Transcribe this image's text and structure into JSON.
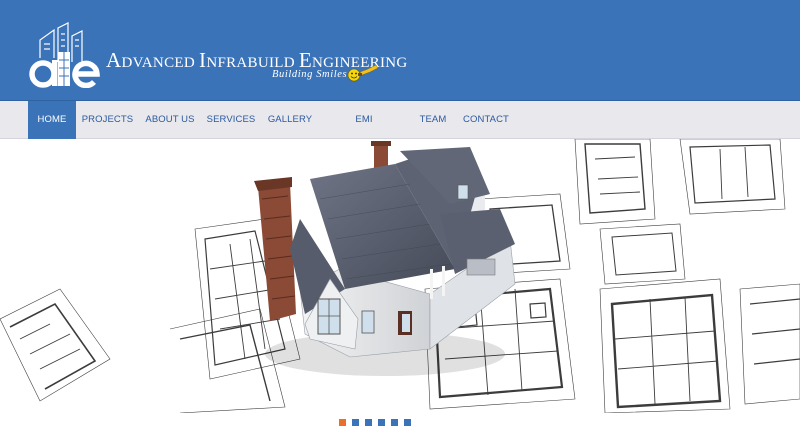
{
  "brand": {
    "logo_text": "aie",
    "name_initial_1": "A",
    "name_rest_1": "DVANCED ",
    "name_initial_2": "I",
    "name_rest_2": "NFRABUILD ",
    "name_initial_3": "E",
    "name_rest_3": "NGINEERING",
    "tagline": "Building Smiles"
  },
  "nav": {
    "items": [
      {
        "label": "HOME"
      },
      {
        "label": "PROJECTS"
      },
      {
        "label": "ABOUT US"
      },
      {
        "label": "SERVICES"
      },
      {
        "label": "GALLERY"
      },
      {
        "label": "EMI CALCULATOR"
      },
      {
        "label": "TEAM"
      },
      {
        "label": "CONTACT"
      }
    ],
    "active": "HOME"
  },
  "hero": {
    "image": "house-on-blueprints-icon"
  },
  "slider": {
    "slide_count": 6,
    "active_slide": 1
  },
  "colors": {
    "header_bg": "#3b73b9",
    "nav_bg": "#e8e8ed",
    "nav_text": "#2c5a9e",
    "active_dot": "#e8702c"
  }
}
